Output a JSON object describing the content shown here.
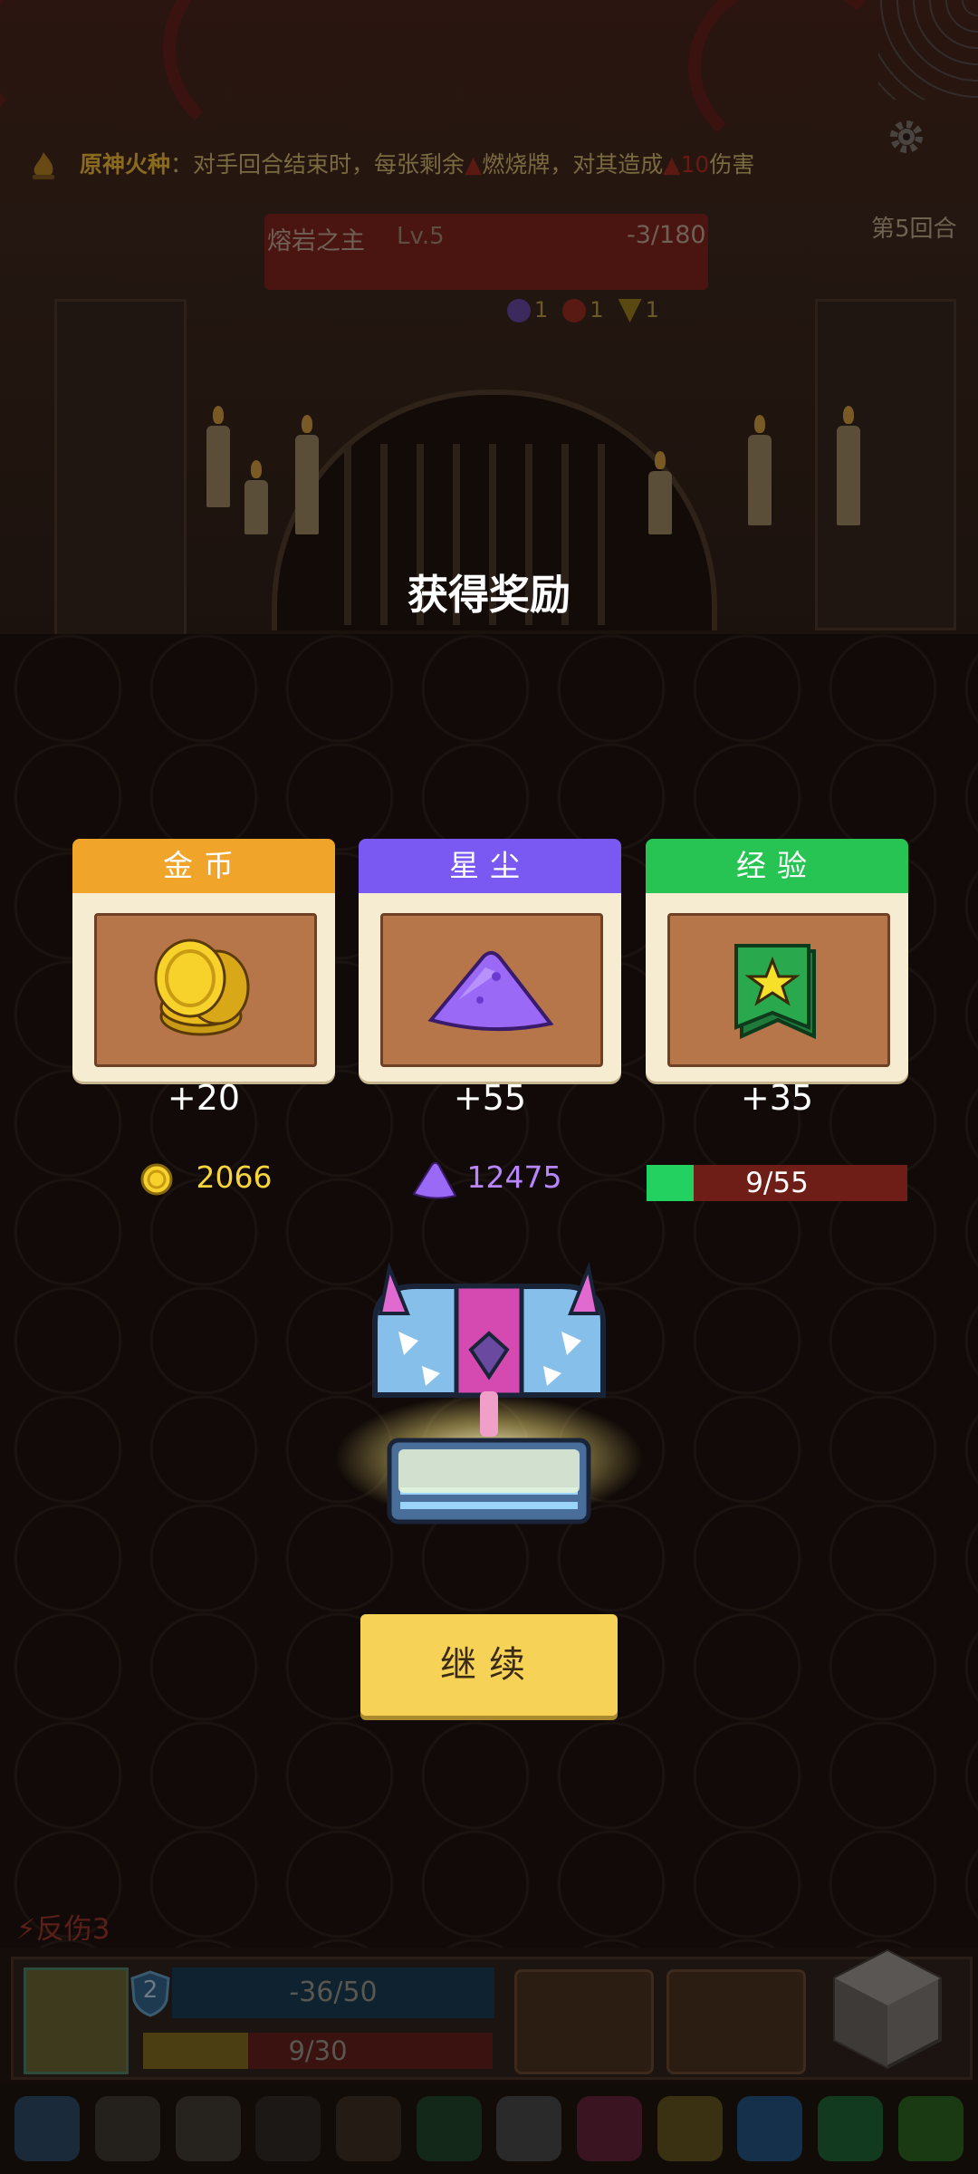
{
  "hud": {
    "buff_name": "原神火种",
    "buff_desc_1": "：对手回合结束时，每张剩余",
    "buff_keyword": "燃烧牌",
    "buff_desc_2": "，对其造成",
    "buff_damage": "10",
    "buff_desc_3": "伤害",
    "boss_name": "熔岩之主",
    "boss_level": "Lv.5",
    "boss_hp": "-3/180",
    "round": "第5回合",
    "statuses": [
      {
        "icon": "frost-icon",
        "value": "1",
        "color": "#5a3e8a"
      },
      {
        "icon": "burn-icon",
        "value": "1",
        "color": "#7a2218"
      },
      {
        "icon": "triangle-icon",
        "value": "1",
        "color": "#7a6a1a"
      }
    ]
  },
  "reward": {
    "title": "获得奖励",
    "cards": [
      {
        "label": "金币",
        "amount": "+20",
        "color": "#f0a42a",
        "icon": "gold-coins-icon"
      },
      {
        "label": "星尘",
        "amount": "+55",
        "color": "#7a58f2",
        "icon": "stardust-icon"
      },
      {
        "label": "经验",
        "amount": "+35",
        "color": "#27c454",
        "icon": "experience-badge-icon"
      }
    ],
    "gold_total": "2066",
    "gold_color": "#f6d63a",
    "stardust_total": "12475",
    "stardust_color": "#b887ff",
    "exp_text": "9/55",
    "exp_progress": 0.18,
    "continue_label": "继续"
  },
  "player": {
    "thorns_label": "反伤3",
    "shield_value": "2",
    "hp_text": "-36/50",
    "energy_text": "9/30",
    "energy_progress": 0.3
  },
  "tray": [
    "spiked-ball-icon",
    "round-charm-icon",
    "gear-charm-icon",
    "bomb-icon",
    "dagger-icon",
    "clover-icon",
    "armor-icon",
    "demon-mask-icon",
    "crown-icon",
    "gem-shield-icon",
    "emerald-icon",
    "leaf-icon"
  ]
}
